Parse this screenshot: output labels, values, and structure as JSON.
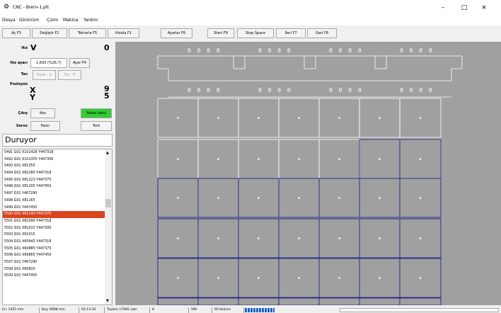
{
  "window": {
    "title": "CNC - Brern-1.plt",
    "minimize": "–",
    "maximize": "□",
    "close": "×"
  },
  "menu": [
    "Dosya",
    "Görünüm",
    "Çizim",
    "Makina",
    "Yardım"
  ],
  "toolbar": [
    "Aç F3",
    "Değiştir F2",
    "Tekrarla F5",
    "Hizala F1",
    "Ayarlar F6",
    "Start F9",
    "Stop Space",
    "İleri F7",
    "Geri F8"
  ],
  "panel": {
    "hiz_label": "Hız",
    "hiz_value": "V",
    "hiz_num": "0",
    "hiz_ayari_label": "Hız ayarı",
    "hiz_ayari_value": "1,600 (%26.7)",
    "ayar_button": "Ayar F4",
    "tav_label": "Tav",
    "tav_btn1": "Bırak - 0",
    "tav_btn2": "Tut - H",
    "pozisyon_label": "Pozisyon",
    "x_label": "X",
    "x_value": "9",
    "y_label": "Y",
    "y_value": "5",
    "cikis_label": "Çıkış",
    "cikis_btn1": "Kes",
    "cikis_btn2": "Yakan boku",
    "servo_label": "Servo",
    "servo_btn1": "Hazır",
    "servo_btn2": "Tork",
    "status": "Duruyor"
  },
  "gcode_list": [
    "5491 G01 X101428 Y447318",
    "5492 G01 X101355 Y447300",
    "5493 G01 X81355",
    "5494 G01 X81280 Y447318",
    "5495 G01 X81223 Y447375",
    "5496 G01 X81205 Y447450",
    "5497 G01 Y467290",
    "5498 G01 X81165",
    "5499 G01 Y447450",
    "5500 G01 X81140 Y447375",
    "5501 G01 X81090 Y447318",
    "5502 G01 X81015 Y447300",
    "5503 G01 X61015",
    "5504 G01 X60943 Y447318",
    "5505 G01 X60885 Y447375",
    "5506 G01 X60865 Y447450",
    "5507 G01 Y467290",
    "5508 G01 X60820",
    "5509 G01 Y447450"
  ],
  "selected_index": 9,
  "canvas": {
    "number_text": "0 0 0 0"
  },
  "statusbar": [
    "En: 1455 mm",
    "Boy: 8988 mm",
    "02:13:30",
    "Toplam 17685 satır",
    "8",
    "SIM",
    "60 blok/sn"
  ],
  "colors": {
    "selected": "#d9441f",
    "green": "#33cc33",
    "canvas_bg": "#a0a0a0",
    "blue_line": "#2b2f8a",
    "progress": "#1e5fc4"
  }
}
